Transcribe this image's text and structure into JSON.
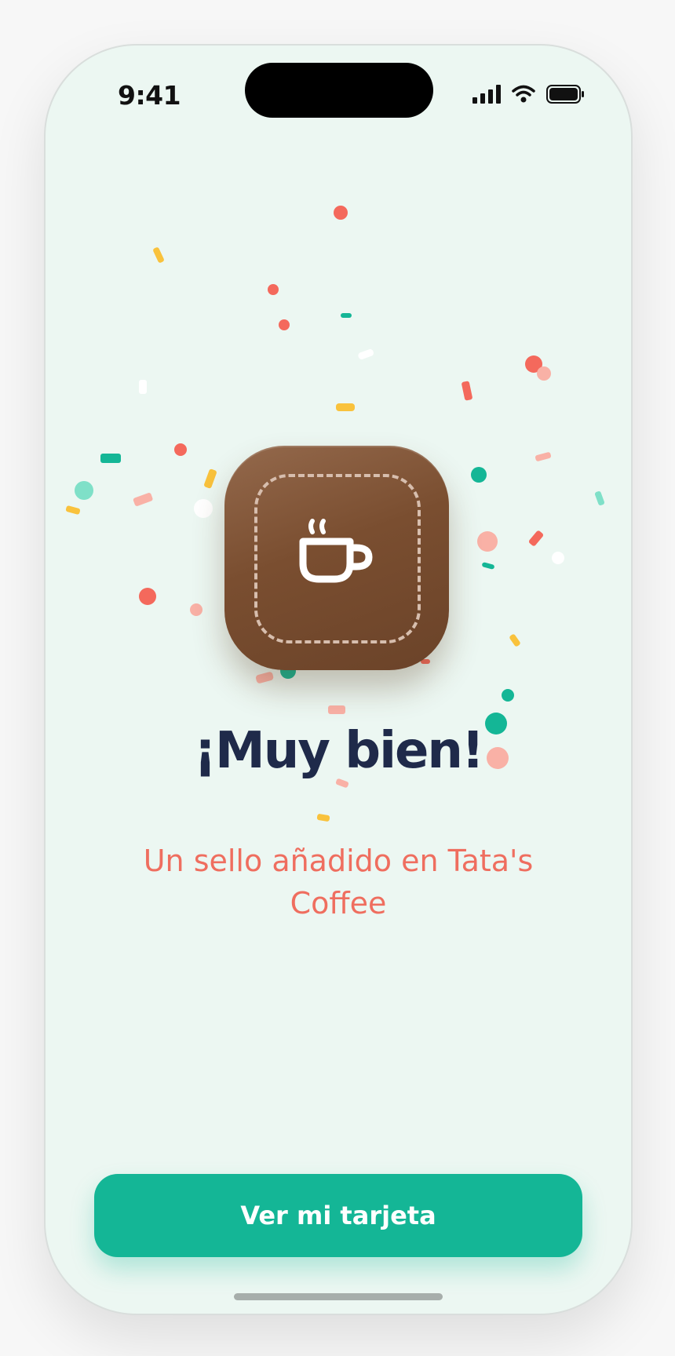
{
  "status_bar": {
    "time": "9:41"
  },
  "stamp": {
    "icon": "coffee-cup-icon"
  },
  "message": {
    "title": "¡Muy bien!",
    "subtitle": "Un sello añadido en Tata's Coffee"
  },
  "cta": {
    "label": "Ver mi tarjeta"
  },
  "colors": {
    "background": "#ecf7f2",
    "title": "#1f2a4a",
    "subtitle": "#ef6e5f",
    "button": "#14b696",
    "stamp": "#7a4e30"
  }
}
